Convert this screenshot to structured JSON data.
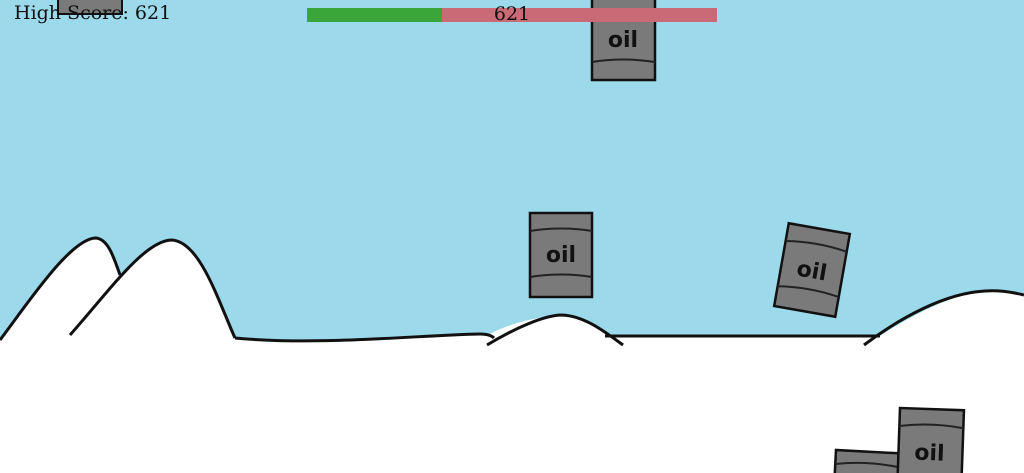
{
  "hud": {
    "high_score_label": "High Score:",
    "high_score_value": "621",
    "progress_value": "621",
    "progress_fraction": 0.33
  },
  "barrel_label": "oil",
  "colors": {
    "sky": "#9bd9eb",
    "snow": "#ffffff",
    "barrel": "#7a7a7a",
    "progress_fill": "#3aa63a",
    "progress_track": "#c96a76"
  }
}
